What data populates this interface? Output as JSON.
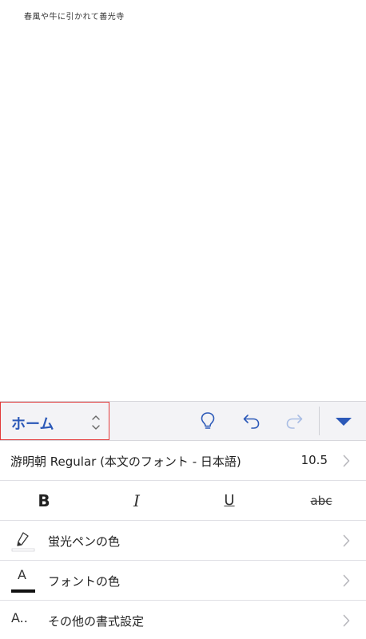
{
  "document": {
    "text": "春風や牛に引かれて善光寺"
  },
  "ribbon": {
    "tab_label": "ホーム",
    "buttons": [
      {
        "name": "lightbulb-icon",
        "enabled": true
      },
      {
        "name": "undo-icon",
        "enabled": true
      },
      {
        "name": "redo-icon",
        "enabled": false
      },
      {
        "name": "collapse-ribbon-icon",
        "enabled": true
      }
    ],
    "accent_color": "#2c59b8",
    "highlight_border_color": "#e23a3a"
  },
  "font_row": {
    "font_name": "游明朝 Regular (本文のフォント - 日本語)",
    "font_size": "10.5"
  },
  "format_buttons": {
    "bold": "B",
    "italic": "I",
    "underline": "U",
    "strikethrough": "abc"
  },
  "highlight_row": {
    "label": "蛍光ペンの色"
  },
  "font_color_row": {
    "label": "フォントの色",
    "icon_letter": "A"
  },
  "more_format_row": {
    "label": "その他の書式設定",
    "icon_text": "A.."
  }
}
